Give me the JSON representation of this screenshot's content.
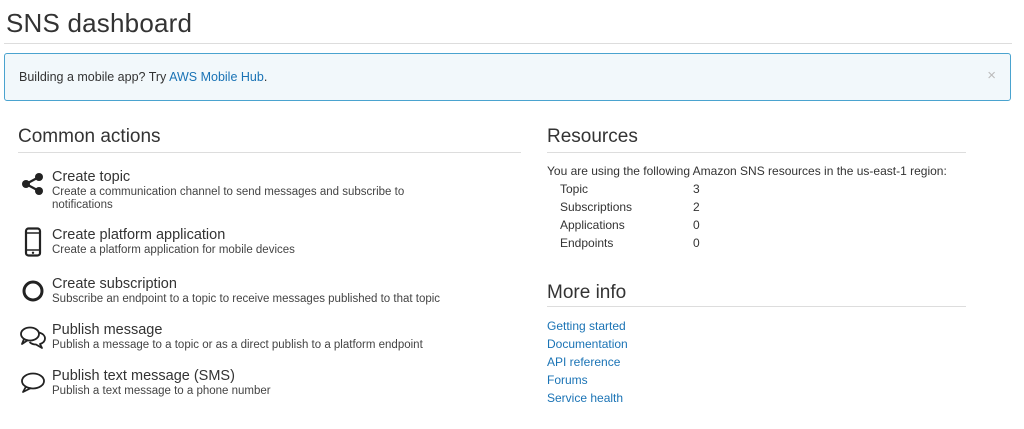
{
  "header": {
    "title": "SNS dashboard"
  },
  "banner": {
    "text": "Building a mobile app? Try ",
    "link_label": "AWS Mobile Hub",
    "suffix": ".",
    "close_glyph": "×"
  },
  "common_actions": {
    "title": "Common actions",
    "items": [
      {
        "icon": "share-icon",
        "title": "Create topic",
        "description": "Create a communication channel to send messages and subscribe to notifications"
      },
      {
        "icon": "mobile-phone-icon",
        "title": "Create platform application",
        "description": "Create a platform application for mobile devices"
      },
      {
        "icon": "circle-icon",
        "title": "Create subscription",
        "description": "Subscribe an endpoint to a topic to receive messages published to that topic"
      },
      {
        "icon": "chat-bubbles-icon",
        "title": "Publish message",
        "description": "Publish a message to a topic or as a direct publish to a platform endpoint"
      },
      {
        "icon": "speech-bubble-icon",
        "title": "Publish text message (SMS)",
        "description": "Publish a text message to a phone number"
      }
    ]
  },
  "resources": {
    "title": "Resources",
    "intro": "You are using the following Amazon SNS resources in the us-east-1 region:",
    "rows": [
      {
        "label": "Topic",
        "value": "3"
      },
      {
        "label": "Subscriptions",
        "value": "2"
      },
      {
        "label": "Applications",
        "value": "0"
      },
      {
        "label": "Endpoints",
        "value": "0"
      }
    ]
  },
  "more_info": {
    "title": "More info",
    "links": [
      "Getting started",
      "Documentation",
      "API reference",
      "Forums",
      "Service health"
    ]
  },
  "colors": {
    "link": "#1a73b5",
    "banner_border": "#4aa3cf",
    "banner_bg": "#f2f8fb"
  }
}
